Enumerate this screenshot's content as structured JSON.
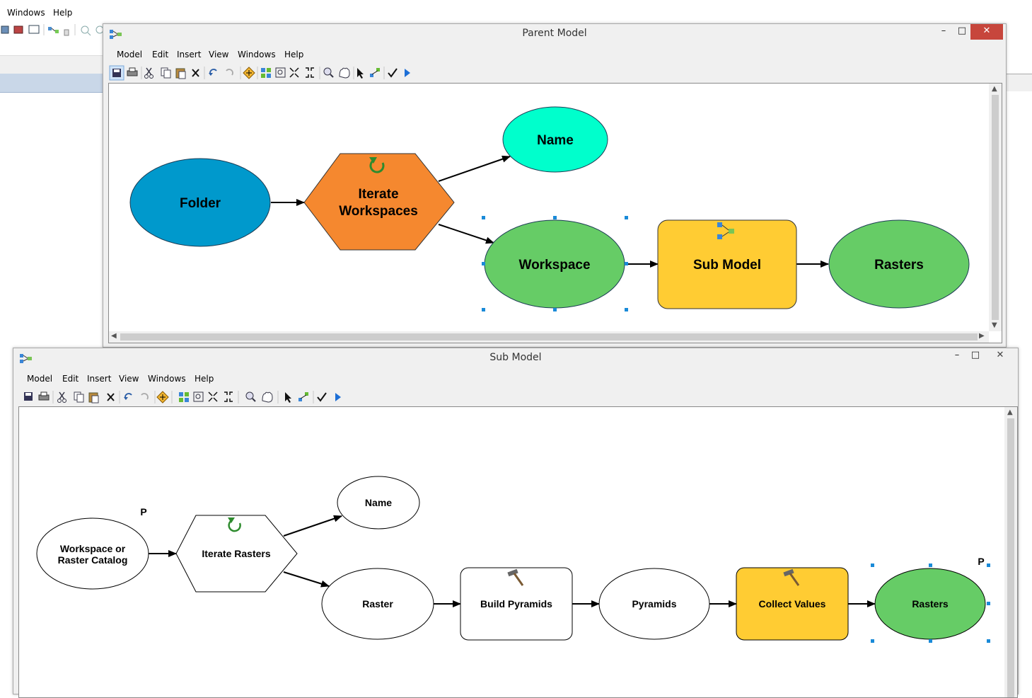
{
  "background_app": {
    "menu": [
      "Windows",
      "Help"
    ]
  },
  "parent_window": {
    "title": "Parent Model",
    "menu": [
      "Model",
      "Edit",
      "Insert",
      "View",
      "Windows",
      "Help"
    ],
    "nodes": {
      "folder": "Folder",
      "iterate_line1": "Iterate",
      "iterate_line2": "Workspaces",
      "name": "Name",
      "workspace": "Workspace",
      "sub_model": "Sub Model",
      "rasters": "Rasters"
    },
    "colors": {
      "folder": "#0099cc",
      "iterator": "#f5882f",
      "name": "#00ffcc",
      "derived": "#66cc66",
      "sub_model": "#ffcc33"
    }
  },
  "sub_window": {
    "title": "Sub Model",
    "menu": [
      "Model",
      "Edit",
      "Insert",
      "View",
      "Windows",
      "Help"
    ],
    "nodes": {
      "workspace_line1": "Workspace or",
      "workspace_line2": "Raster Catalog",
      "param_marker": "P",
      "iterate": "Iterate Rasters",
      "name": "Name",
      "raster": "Raster",
      "build_pyramids": "Build Pyramids",
      "pyramids": "Pyramids",
      "collect_values": "Collect Values",
      "rasters": "Rasters",
      "param_marker_2": "P"
    }
  },
  "window_controls": {
    "minimize": "–",
    "maximize": "□",
    "close": "✕"
  }
}
